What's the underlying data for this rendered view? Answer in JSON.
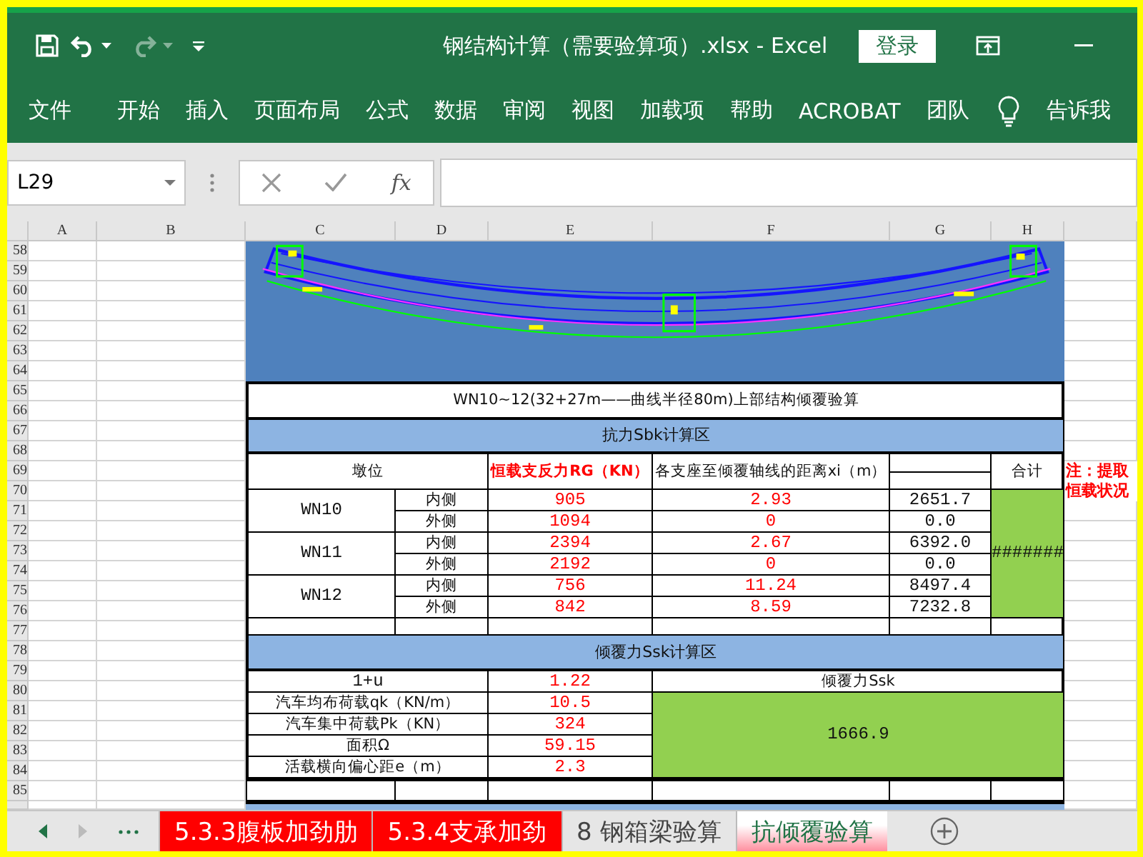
{
  "window": {
    "title": "钢结构计算（需要验算项）.xlsx  -  Excel",
    "sign_in": "登录"
  },
  "ribbon_tabs": [
    "文件",
    "开始",
    "插入",
    "页面布局",
    "公式",
    "数据",
    "审阅",
    "视图",
    "加载项",
    "帮助",
    "ACROBAT",
    "团队"
  ],
  "tell_me": "告诉我",
  "formula_bar": {
    "name_box": "L29",
    "fx": "fx"
  },
  "columns": [
    "A",
    "B",
    "C",
    "D",
    "E",
    "F",
    "G",
    "H"
  ],
  "rows": [
    "58",
    "59",
    "60",
    "61",
    "62",
    "63",
    "64",
    "65",
    "66",
    "67",
    "68",
    "69",
    "70",
    "71",
    "72",
    "73",
    "74",
    "75",
    "76",
    "77",
    "78",
    "79",
    "80",
    "81",
    "82",
    "83",
    "84",
    "85"
  ],
  "calc": {
    "title": "WN10~12(32+27m——曲线半径80m)上部结构倾覆验算",
    "resistance_header": "抗力Sbk计算区",
    "pier_header": "墩位",
    "reaction_header": "恒载支反力RG（KN）",
    "distance_header": "各支座至倾覆轴线的距离xi（m）",
    "total_header": "合计",
    "piers": [
      {
        "name": "WN10",
        "bearings": [
          {
            "side": "内侧",
            "reaction": "905",
            "distance": "2.93",
            "product": "2651.7"
          },
          {
            "side": "外侧",
            "reaction": "1094",
            "distance": "0",
            "product": "0.0"
          }
        ]
      },
      {
        "name": "WN11",
        "bearings": [
          {
            "side": "内侧",
            "reaction": "2394",
            "distance": "2.67",
            "product": "6392.0"
          },
          {
            "side": "外侧",
            "reaction": "2192",
            "distance": "0",
            "product": "0.0"
          }
        ]
      },
      {
        "name": "WN12",
        "bearings": [
          {
            "side": "内侧",
            "reaction": "756",
            "distance": "11.24",
            "product": "8497.4"
          },
          {
            "side": "外侧",
            "reaction": "842",
            "distance": "8.59",
            "product": "7232.8"
          }
        ]
      }
    ],
    "total_value": "#######",
    "note": [
      "注：提取",
      "恒载状况"
    ],
    "overturning_header": "倾覆力Ssk计算区",
    "params": [
      {
        "label": "1+u",
        "value": "1.22"
      },
      {
        "label": "汽车均布荷载qk（KN/m）",
        "value": "10.5"
      },
      {
        "label": "汽车集中荷载Pk（KN）",
        "value": "324"
      },
      {
        "label": "面积Ω",
        "value": "59.15"
      },
      {
        "label": "活载横向偏心距e（m）",
        "value": "2.3"
      }
    ],
    "ssk_label": "倾覆力Ssk",
    "ssk_value": "1666.9"
  },
  "sheet_tabs": [
    {
      "label": "5.3.3腹板加劲肋",
      "selected": false,
      "color": "#ff0000"
    },
    {
      "label": "5.3.4支承加劲",
      "selected": false,
      "color": "#ff0000"
    },
    {
      "label": "8 钢箱梁验算",
      "selected": false
    },
    {
      "label": "抗倾覆验算",
      "selected": true,
      "color": "#ff8f9f"
    }
  ]
}
